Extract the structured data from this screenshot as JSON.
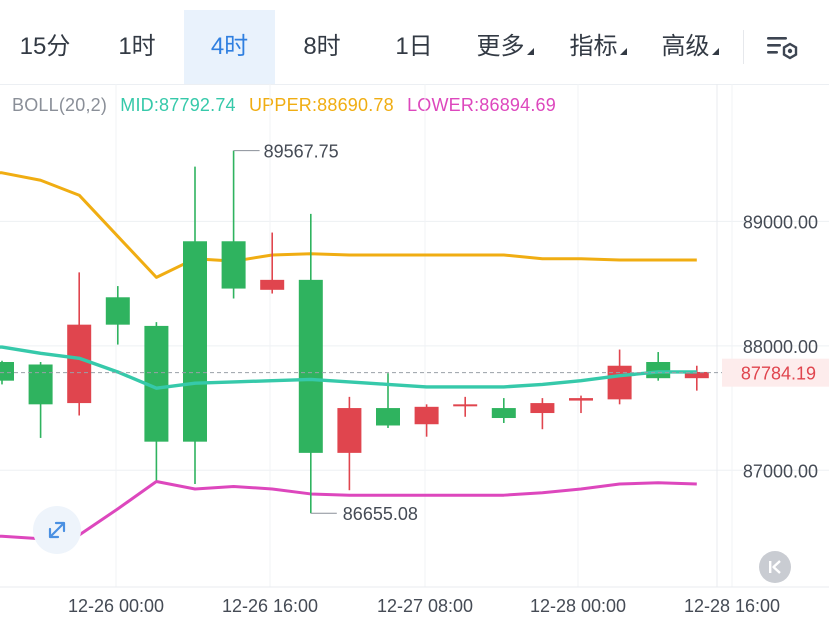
{
  "tabs": [
    {
      "label": "15分",
      "active": false,
      "dropdown": false
    },
    {
      "label": "1时",
      "active": false,
      "dropdown": false
    },
    {
      "label": "4时",
      "active": true,
      "dropdown": false
    },
    {
      "label": "8时",
      "active": false,
      "dropdown": false
    },
    {
      "label": "1日",
      "active": false,
      "dropdown": false
    },
    {
      "label": "更多",
      "active": false,
      "dropdown": true
    },
    {
      "label": "指标",
      "active": false,
      "dropdown": true
    },
    {
      "label": "高级",
      "active": false,
      "dropdown": true
    }
  ],
  "indicator": {
    "name": "BOLL(20,2)",
    "mid": "MID:87792.74",
    "upper": "UPPER:88690.78",
    "lower": "LOWER:86894.69"
  },
  "colors": {
    "up": "#2fb35f",
    "down": "#e0454e",
    "mid": "#36c9aa",
    "upper": "#f0ad12",
    "lower": "#dd47bd",
    "accent": "#2f7fe0",
    "price_tag": "#e0454e"
  },
  "chart_data": {
    "type": "candlestick",
    "y_ticks": [
      "89000.00",
      "88000.00",
      "87000.00"
    ],
    "x_ticks": [
      "12-26 00:00",
      "12-26 16:00",
      "12-27 08:00",
      "12-28 00:00",
      "12-28 16:00"
    ],
    "last_price": "87784.19",
    "max_label": "89567.75",
    "min_label": "86655.08",
    "ylim": [
      86440,
      89750
    ],
    "candles": [
      {
        "o": 87720,
        "h": 87880,
        "l": 87690,
        "c": 87870
      },
      {
        "o": 87530,
        "h": 87870,
        "l": 87260,
        "c": 87850
      },
      {
        "o": 88170,
        "h": 88590,
        "l": 87440,
        "c": 87540
      },
      {
        "o": 88170,
        "h": 88480,
        "l": 88010,
        "c": 88390
      },
      {
        "o": 87230,
        "h": 88190,
        "l": 86920,
        "c": 88160
      },
      {
        "o": 87230,
        "h": 89440,
        "l": 86890,
        "c": 88840
      },
      {
        "o": 88460,
        "h": 89567.75,
        "l": 88380,
        "c": 88840
      },
      {
        "o": 88530,
        "h": 88910,
        "l": 88420,
        "c": 88450
      },
      {
        "o": 87140,
        "h": 89060,
        "l": 86655.08,
        "c": 88530
      },
      {
        "o": 87500,
        "h": 87590,
        "l": 86840,
        "c": 87140
      },
      {
        "o": 87360,
        "h": 87780,
        "l": 87340,
        "c": 87500
      },
      {
        "o": 87510,
        "h": 87530,
        "l": 87270,
        "c": 87370
      },
      {
        "o": 87530,
        "h": 87590,
        "l": 87430,
        "c": 87520
      },
      {
        "o": 87420,
        "h": 87580,
        "l": 87380,
        "c": 87500
      },
      {
        "o": 87540,
        "h": 87580,
        "l": 87330,
        "c": 87460
      },
      {
        "o": 87580,
        "h": 87600,
        "l": 87460,
        "c": 87560
      },
      {
        "o": 87840,
        "h": 87970,
        "l": 87530,
        "c": 87570
      },
      {
        "o": 87740,
        "h": 87950,
        "l": 87720,
        "c": 87870
      },
      {
        "o": 87790,
        "h": 87840,
        "l": 87640,
        "c": 87740
      }
    ],
    "boll": {
      "upper": [
        89390,
        89330,
        89210,
        88880,
        88550,
        88700,
        88680,
        88730,
        88740,
        88730,
        88730,
        88730,
        88730,
        88730,
        88700,
        88700,
        88690,
        88690,
        88690
      ],
      "mid": [
        87990,
        87940,
        87900,
        87790,
        87660,
        87700,
        87710,
        87720,
        87730,
        87710,
        87690,
        87670,
        87670,
        87670,
        87690,
        87720,
        87760,
        87790,
        87790
      ],
      "lower": [
        86470,
        86450,
        86480,
        86690,
        86910,
        86850,
        86870,
        86850,
        86810,
        86800,
        86800,
        86800,
        86800,
        86800,
        86820,
        86850,
        86890,
        86900,
        86890
      ]
    }
  }
}
